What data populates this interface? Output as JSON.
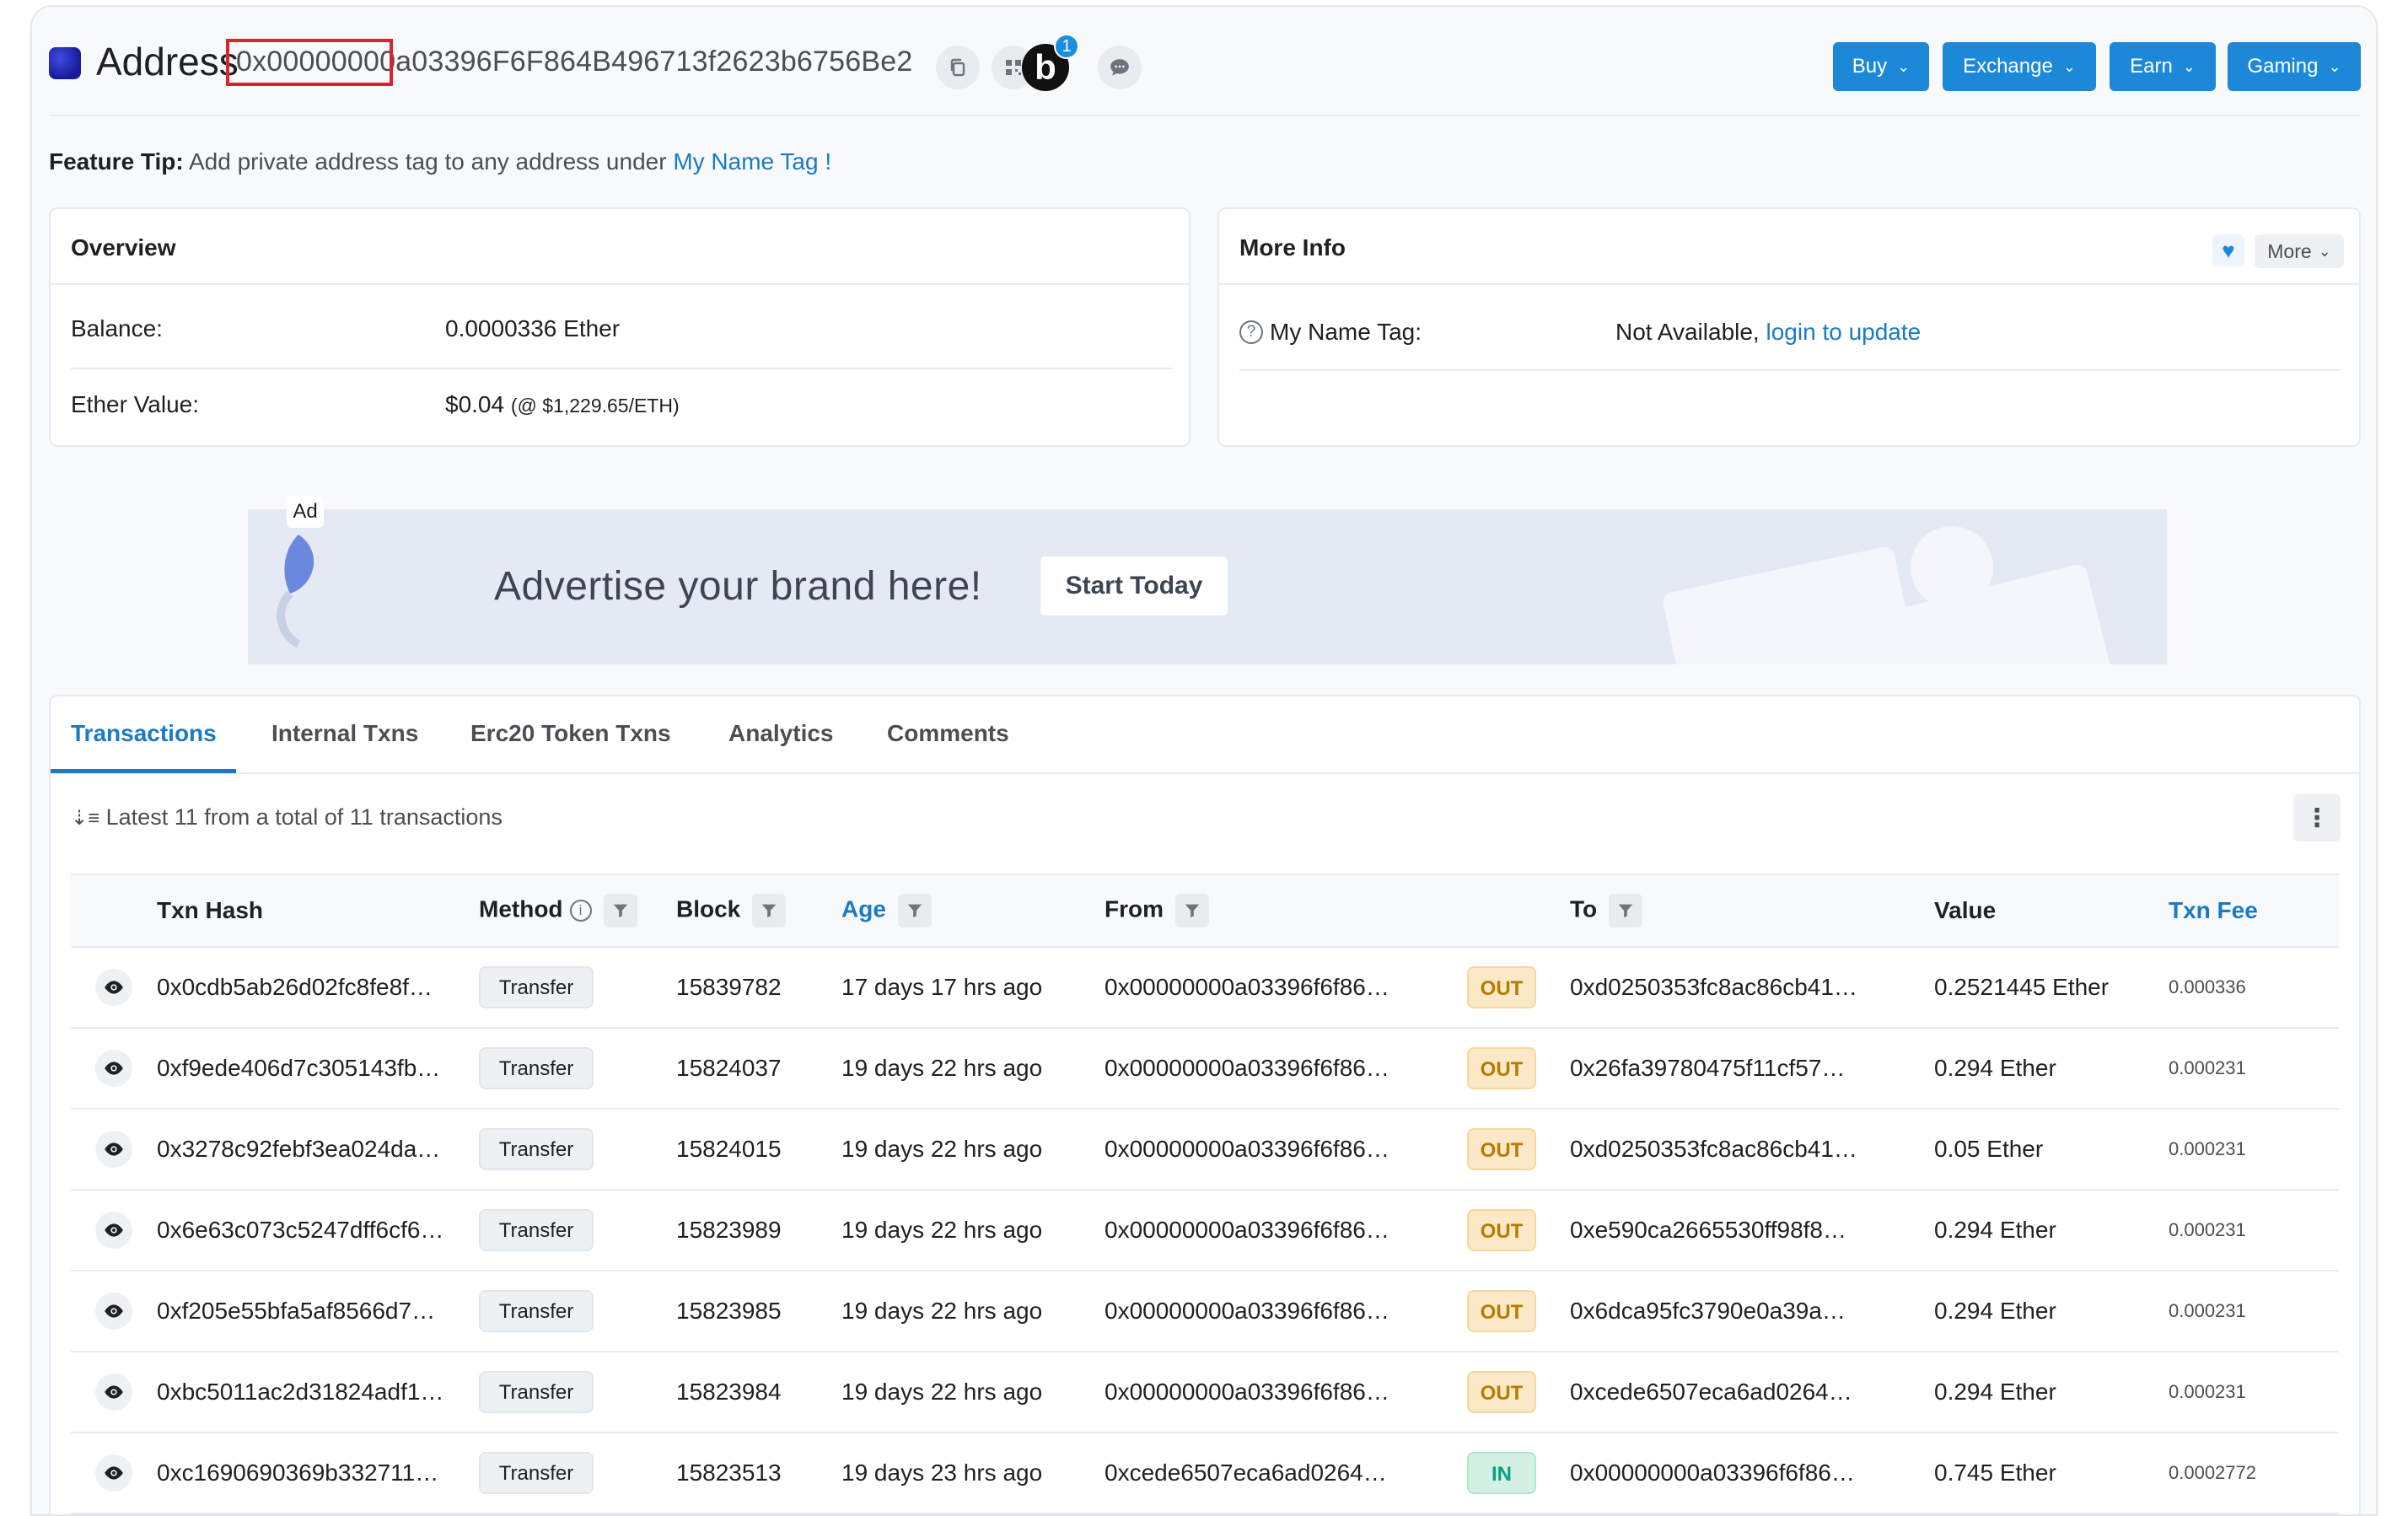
{
  "header": {
    "label": "Address",
    "address": "0x00000000a03396F6F864B496713f2623b6756Be2",
    "blockscan_letter": "b",
    "blockscan_count": "1",
    "buttons": [
      {
        "label": "Buy"
      },
      {
        "label": "Exchange"
      },
      {
        "label": "Earn"
      },
      {
        "label": "Gaming"
      }
    ],
    "button_color": "#1e88d8"
  },
  "tip": {
    "prefix": "Feature Tip:",
    "text": "Add private address tag to any address under",
    "link": "My Name Tag !"
  },
  "overview": {
    "title": "Overview",
    "balance_label": "Balance:",
    "balance_value": "0.0000336 Ether",
    "ether_value_label": "Ether Value:",
    "ether_value": "$0.04",
    "ether_rate": "(@ $1,229.65/ETH)"
  },
  "more_info": {
    "title": "More Info",
    "more_label": "More",
    "name_tag_label": "My Name Tag:",
    "name_tag_value": "Not Available,",
    "name_tag_link": "login to update"
  },
  "ad": {
    "tag": "Ad",
    "headline": "Advertise your brand here!",
    "button": "Start Today"
  },
  "tabs": [
    {
      "label": "Transactions",
      "active": true
    },
    {
      "label": "Internal Txns"
    },
    {
      "label": "Erc20 Token Txns"
    },
    {
      "label": "Analytics"
    },
    {
      "label": "Comments"
    }
  ],
  "summary": "Latest 11 from a total of 11 transactions",
  "table": {
    "columns": {
      "hash": "Txn Hash",
      "method": "Method",
      "block": "Block",
      "age": "Age",
      "from": "From",
      "to": "To",
      "value": "Value",
      "fee": "Txn Fee"
    },
    "rows": [
      {
        "hash": "0x0cdb5ab26d02fc8fe8f…",
        "method": "Transfer",
        "block": "15839782",
        "age": "17 days 17 hrs ago",
        "from": "0x00000000a03396f6f86…",
        "dir": "OUT",
        "to": "0xd0250353fc8ac86cb41…",
        "value": "0.2521445 Ether",
        "fee": "0.000336"
      },
      {
        "hash": "0xf9ede406d7c305143fb…",
        "method": "Transfer",
        "block": "15824037",
        "age": "19 days 22 hrs ago",
        "from": "0x00000000a03396f6f86…",
        "dir": "OUT",
        "to": "0x26fa39780475f11cf57…",
        "value": "0.294 Ether",
        "fee": "0.000231"
      },
      {
        "hash": "0x3278c92febf3ea024da…",
        "method": "Transfer",
        "block": "15824015",
        "age": "19 days 22 hrs ago",
        "from": "0x00000000a03396f6f86…",
        "dir": "OUT",
        "to": "0xd0250353fc8ac86cb41…",
        "value": "0.05 Ether",
        "fee": "0.000231"
      },
      {
        "hash": "0x6e63c073c5247dff6cf6…",
        "method": "Transfer",
        "block": "15823989",
        "age": "19 days 22 hrs ago",
        "from": "0x00000000a03396f6f86…",
        "dir": "OUT",
        "to": "0xe590ca2665530ff98f8…",
        "value": "0.294 Ether",
        "fee": "0.000231"
      },
      {
        "hash": "0xf205e55bfa5af8566d7…",
        "method": "Transfer",
        "block": "15823985",
        "age": "19 days 22 hrs ago",
        "from": "0x00000000a03396f6f86…",
        "dir": "OUT",
        "to": "0x6dca95fc3790e0a39a…",
        "value": "0.294 Ether",
        "fee": "0.000231"
      },
      {
        "hash": "0xbc5011ac2d31824adf1…",
        "method": "Transfer",
        "block": "15823984",
        "age": "19 days 22 hrs ago",
        "from": "0x00000000a03396f6f86…",
        "dir": "OUT",
        "to": "0xcede6507eca6ad0264…",
        "value": "0.294 Ether",
        "fee": "0.000231"
      },
      {
        "hash": "0xc1690690369b332711…",
        "method": "Transfer",
        "block": "15823513",
        "age": "19 days 23 hrs ago",
        "from": "0xcede6507eca6ad0264…",
        "dir": "IN",
        "to": "0x00000000a03396f6f86…",
        "value": "0.745 Ether",
        "fee": "0.0002772"
      }
    ]
  }
}
